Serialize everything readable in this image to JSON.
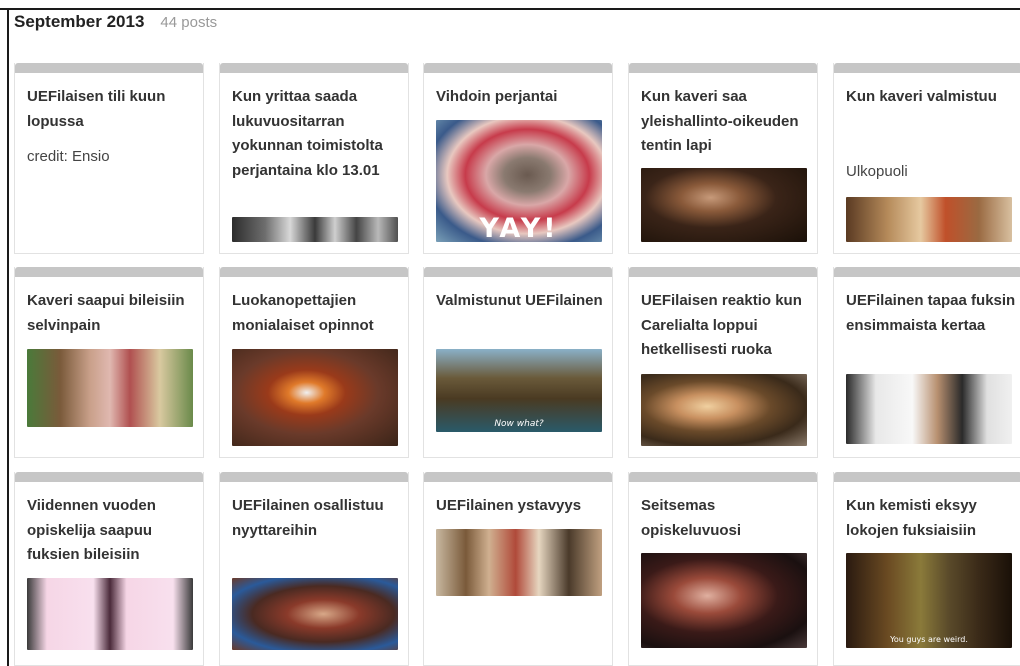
{
  "header": {
    "month": "September 2013",
    "count": "44 posts"
  },
  "cards": [
    {
      "title": "UEFilaisen tili kuun lopussa",
      "subtitle": "credit: Ensio"
    },
    {
      "title": "Kun yrittaa saada lukuvuositarran yokunnan toimistolta perjantaina klo 13.01"
    },
    {
      "title": "Vihdoin perjantai",
      "caption": "YAY!"
    },
    {
      "title": "Kun kaveri saa yleishallinto-oikeuden tentin lapi"
    },
    {
      "title": "Kun kaveri valmistuu",
      "subtitle": "Ulkopuoli"
    },
    {
      "title": "Kaveri saapui bileisiin selvinpain"
    },
    {
      "title": "Luokanopettajien monialaiset opinnot"
    },
    {
      "title": "Valmistunut UEFilainen",
      "caption": "Now what?"
    },
    {
      "title": "UEFilaisen reaktio kun Carelialta loppui hetkellisesti ruoka"
    },
    {
      "title": "UEFilainen tapaa fuksin ensimmaista kertaa"
    },
    {
      "title": "Viidennen vuoden opiskelija saapuu fuksien bileisiin"
    },
    {
      "title": "UEFilainen osallistuu nyyttareihin"
    },
    {
      "title": "UEFilainen ystavyys"
    },
    {
      "title": "Seitsemas opiskeluvuosi"
    },
    {
      "title": "Kun kemisti eksyy lokojen fuksiaisiin",
      "caption": "You guys are weird."
    }
  ]
}
